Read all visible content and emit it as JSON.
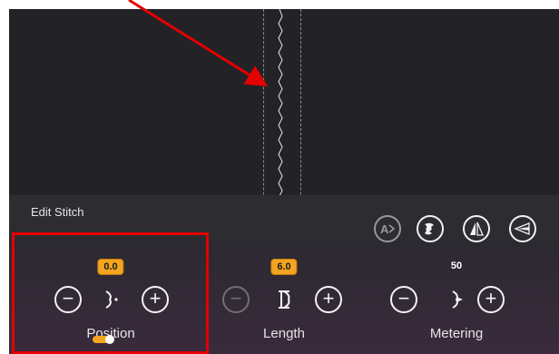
{
  "panel": {
    "title": "Edit Stitch",
    "tools": [
      {
        "icon": "auto-a-icon",
        "enabled": false
      },
      {
        "icon": "stitch-repeat-icon",
        "enabled": true
      },
      {
        "icon": "mirror-icon",
        "enabled": true
      },
      {
        "icon": "metering-tool-icon",
        "enabled": true
      }
    ]
  },
  "controls": {
    "position": {
      "label": "Position",
      "value": "0.0"
    },
    "length": {
      "label": "Length",
      "value": "6.0"
    },
    "metering": {
      "label": "Metering",
      "value": "50"
    }
  },
  "annotation": {
    "color": "#e50000"
  },
  "colors": {
    "accent": "#f3a521",
    "background": "#222124"
  }
}
